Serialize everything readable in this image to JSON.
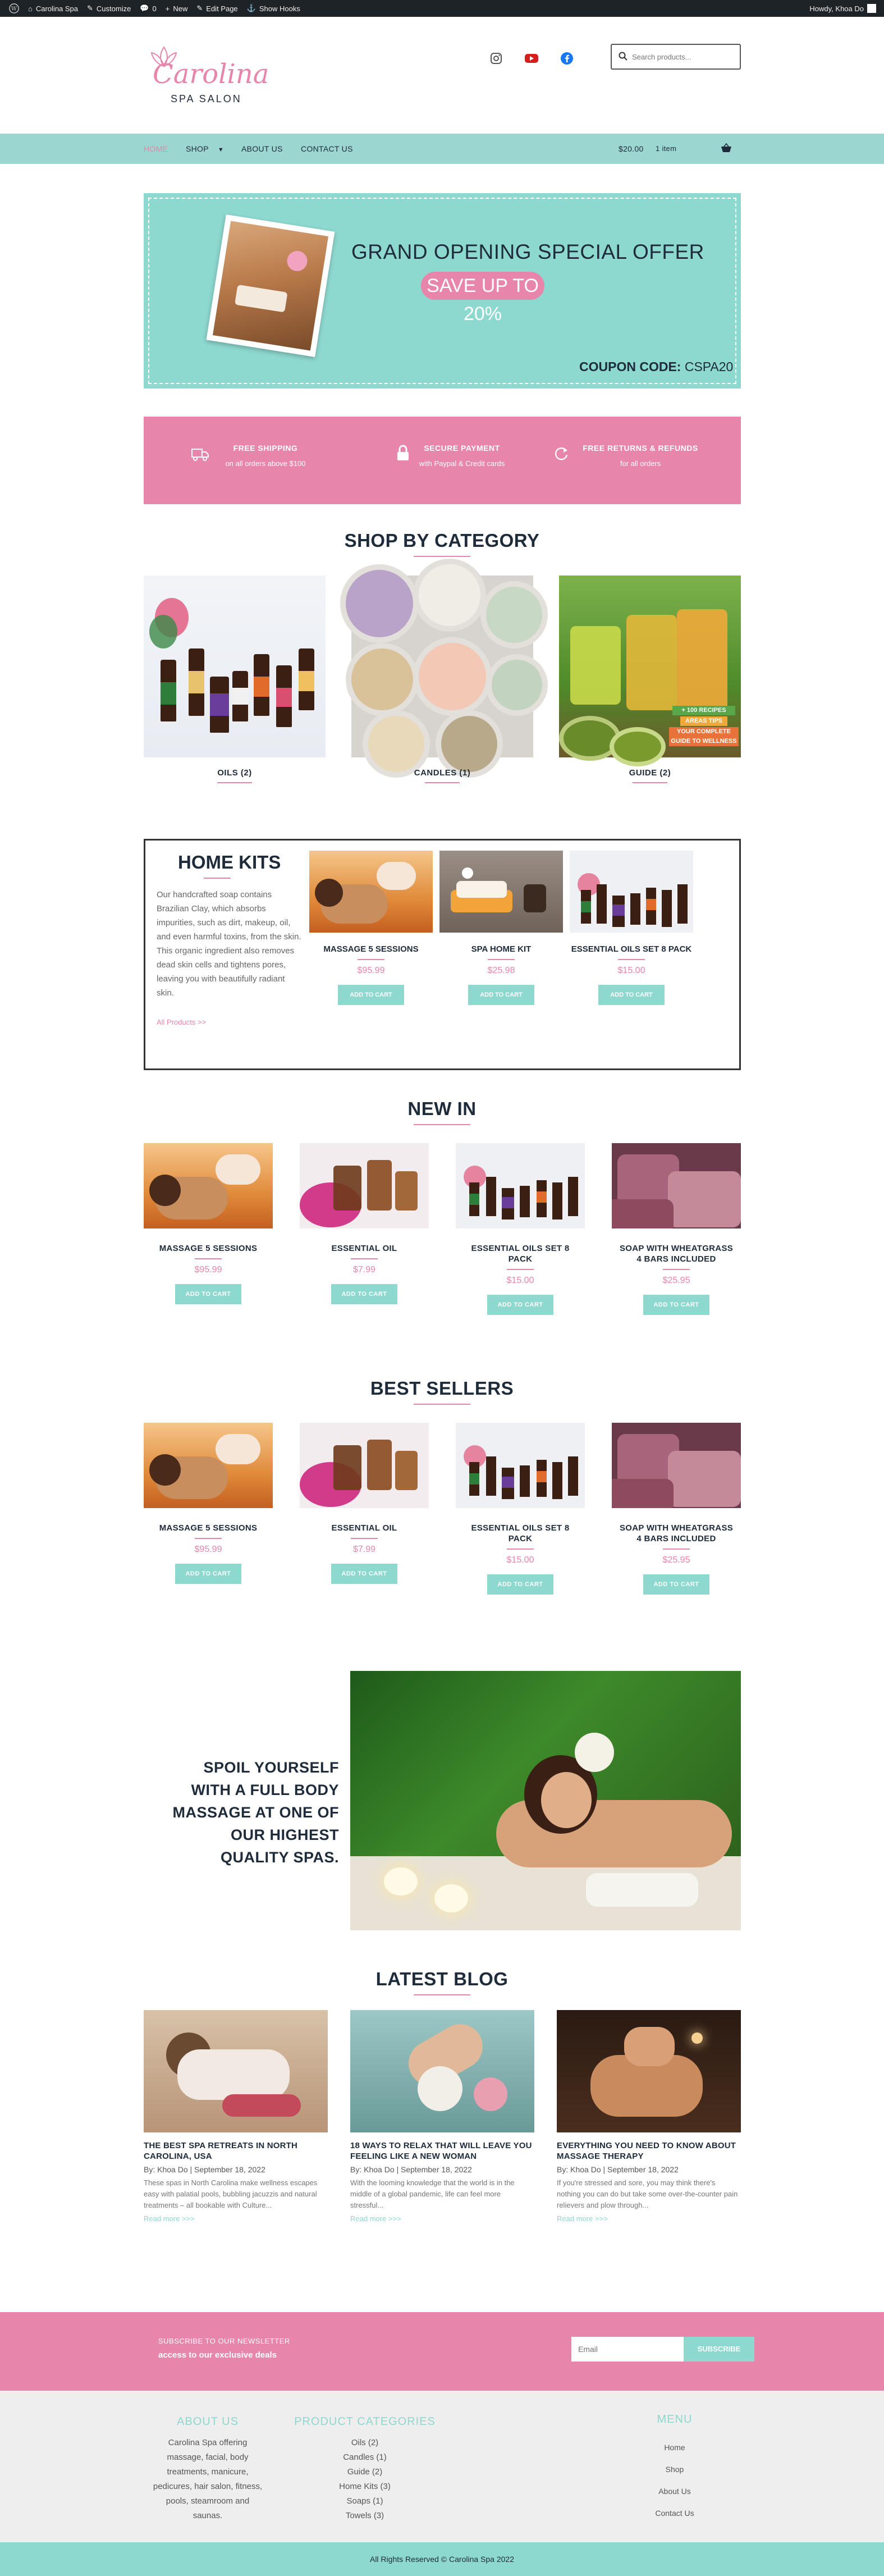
{
  "admin_bar": {
    "site": "Carolina Spa",
    "customize": "Customize",
    "comments": "0",
    "new": "New",
    "edit": "Edit Page",
    "hooks": "Show Hooks",
    "howdy": "Howdy, Khoa Do"
  },
  "header": {
    "logo_script": "Carolina",
    "logo_sub": "SPA SALON",
    "search_placeholder": "Search products..."
  },
  "nav": {
    "items": [
      "HOME",
      "SHOP",
      "ABOUT US",
      "CONTACT US"
    ],
    "cart_total": "$20.00",
    "cart_count": "1 item"
  },
  "banner": {
    "headline": "GRAND OPENING SPECIAL OFFER",
    "badge": "SAVE UP TO 20%",
    "coupon_label": "COUPON CODE:",
    "coupon_code": "CSPA20"
  },
  "features": [
    {
      "title": "FREE SHIPPING",
      "sub": "on all orders above $100",
      "icon": "truck-icon"
    },
    {
      "title": "SECURE PAYMENT",
      "sub": "with Paypal & Credit cards",
      "icon": "lock-icon"
    },
    {
      "title": "FREE RETURNS & REFUNDS",
      "sub": "for all orders",
      "icon": "refresh-icon"
    }
  ],
  "category_section": {
    "heading": "SHOP BY CATEGORY",
    "items": [
      {
        "label": "OILS (2)"
      },
      {
        "label": "CANDLES (1)"
      },
      {
        "label": "GUIDE (2)",
        "overlay": [
          "+ 100 RECIPES",
          "AREAS TIPS",
          "YOUR COMPLETE",
          "GUIDE TO WELLNESS"
        ]
      }
    ]
  },
  "home_kits": {
    "heading": "HOME KITS",
    "description": "Our handcrafted soap contains Brazilian Clay, which absorbs impurities, such as dirt, makeup, oil, and even harmful toxins, from the skin. This organic ingredient also removes dead skin cells and tightens pores, leaving you with beautifully radiant skin.",
    "all_link": "All Products >>",
    "products": [
      {
        "name": "MASSAGE 5 SESSIONS",
        "price": "$95.99",
        "button": "ADD TO CART"
      },
      {
        "name": "SPA HOME KIT",
        "price": "$25.98",
        "button": "ADD TO CART"
      },
      {
        "name": "ESSENTIAL OILS SET 8 PACK",
        "price": "$15.00",
        "button": "ADD TO CART"
      }
    ]
  },
  "new_in": {
    "heading": "NEW IN",
    "products": [
      {
        "name": "MASSAGE 5 SESSIONS",
        "price": "$95.99",
        "button": "ADD TO CART"
      },
      {
        "name": "ESSENTIAL OIL",
        "price": "$7.99",
        "button": "ADD TO CART"
      },
      {
        "name": "ESSENTIAL OILS SET 8 PACK",
        "price": "$15.00",
        "button": "ADD TO CART"
      },
      {
        "name": "SOAP WITH WHEATGRASS 4 BARS INCLUDED",
        "price": "$25.95",
        "button": "ADD TO CART"
      }
    ]
  },
  "best_sellers": {
    "heading": "BEST SELLERS",
    "products": [
      {
        "name": "MASSAGE 5 SESSIONS",
        "price": "$95.99",
        "button": "ADD TO CART"
      },
      {
        "name": "ESSENTIAL OIL",
        "price": "$7.99",
        "button": "ADD TO CART"
      },
      {
        "name": "ESSENTIAL OILS SET 8 PACK",
        "price": "$15.00",
        "button": "ADD TO CART"
      },
      {
        "name": "SOAP WITH WHEATGRASS 4 BARS INCLUDED",
        "price": "$25.95",
        "button": "ADD TO CART"
      }
    ]
  },
  "promo": {
    "text": "SPOIL YOURSELF WITH A FULL BODY MASSAGE AT ONE OF OUR HIGHEST QUALITY SPAS."
  },
  "blog": {
    "heading": "LATEST BLOG",
    "posts": [
      {
        "title": "THE BEST SPA RETREATS IN NORTH CAROLINA, USA",
        "meta": "By: Khoa Do | September 18, 2022",
        "excerpt": "These spas in North Carolina make wellness escapes easy with palatial pools, bubbling jacuzzis and natural treatments – all bookable with Culture...",
        "more": "Read more >>>"
      },
      {
        "title": "18 WAYS TO RELAX THAT WILL LEAVE YOU FEELING LIKE A NEW WOMAN",
        "meta": "By: Khoa Do | September 18, 2022",
        "excerpt": "With the looming knowledge that the world is in the middle of a global pandemic, life can feel more stressful...",
        "more": "Read more >>>"
      },
      {
        "title": "EVERYTHING YOU NEED TO KNOW ABOUT MASSAGE THERAPY",
        "meta": "By: Khoa Do | September 18, 2022",
        "excerpt": "If you're stressed and sore, you may think there's nothing you can do but take some over-the-counter pain relievers and plow through...",
        "more": "Read more >>>"
      }
    ]
  },
  "newsletter": {
    "line1": "SUBSCRIBE TO OUR NEWSLETTER",
    "line2": "access to our exclusive deals",
    "placeholder": "Email",
    "button": "SUBSCRIBE"
  },
  "footer": {
    "about_heading": "ABOUT US",
    "about_text": "Carolina Spa offering massage, facial, body treatments, manicure, pedicures, hair salon, fitness, pools, steamroom and saunas.",
    "cat_heading": "PRODUCT CATEGORIES",
    "categories": [
      "Oils (2)",
      "Candles (1)",
      "Guide (2)",
      "Home Kits (3)",
      "Soaps (1)",
      "Towels (3)"
    ],
    "menu_heading": "MENU",
    "menu": [
      "Home",
      "Shop",
      "About Us",
      "Contact Us"
    ],
    "copyright": "All Rights Reserved © Carolina Spa 2022"
  },
  "colors": {
    "pink": "#e785aa",
    "teal": "#8dd8cf",
    "dark": "#1e2b3a"
  }
}
